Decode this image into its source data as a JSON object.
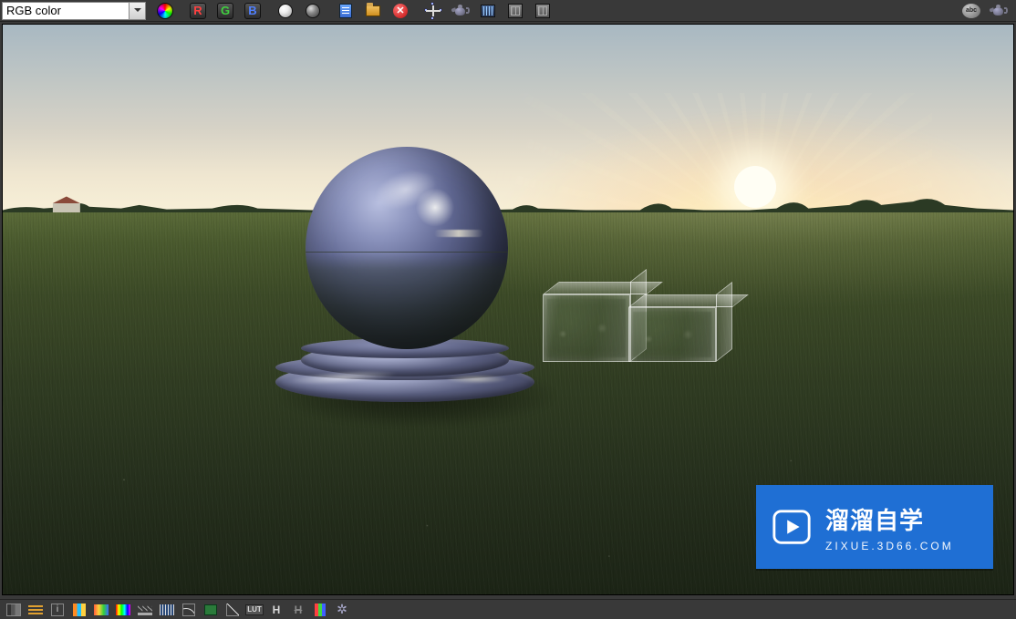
{
  "toolbar": {
    "channel_selector": {
      "value": "RGB color"
    },
    "buttons": {
      "rgb_swirl": "RGB",
      "channel_r": "R",
      "channel_g": "G",
      "channel_b": "B",
      "mono_white": "Mono bright",
      "mono_gray": "Mono dark",
      "save": "Save image",
      "open": "Open image",
      "clear": "Clear",
      "region": "Render region",
      "teapot": "Render",
      "tracks": "Track mouse",
      "compare_a": "Compare A",
      "compare_b": "Compare B",
      "abc": "About",
      "teapot2": "VFB"
    }
  },
  "viewport": {
    "scene": "HDRI sunset grass field",
    "objects": [
      "reflective sphere on pedestal",
      "glass box 1",
      "glass box 2"
    ]
  },
  "watermark": {
    "title": "溜溜自学",
    "subtitle": "ZIXUE.3D66.COM"
  },
  "bottom": {
    "buttons": {
      "histogram": "Histogram",
      "levels": "Levels",
      "info": "i",
      "bars": "Channels",
      "gradient": "Color gradient",
      "rainbow": "Rainbow",
      "highlights": "Highlights",
      "exposure": "Exposure",
      "curve": "Curve",
      "greenbox": "Background",
      "graph": "Graph",
      "lut": "LUT",
      "H_on": "H",
      "H_off": "H",
      "rgb_bars": "RGB",
      "star": "Lens FX"
    }
  }
}
